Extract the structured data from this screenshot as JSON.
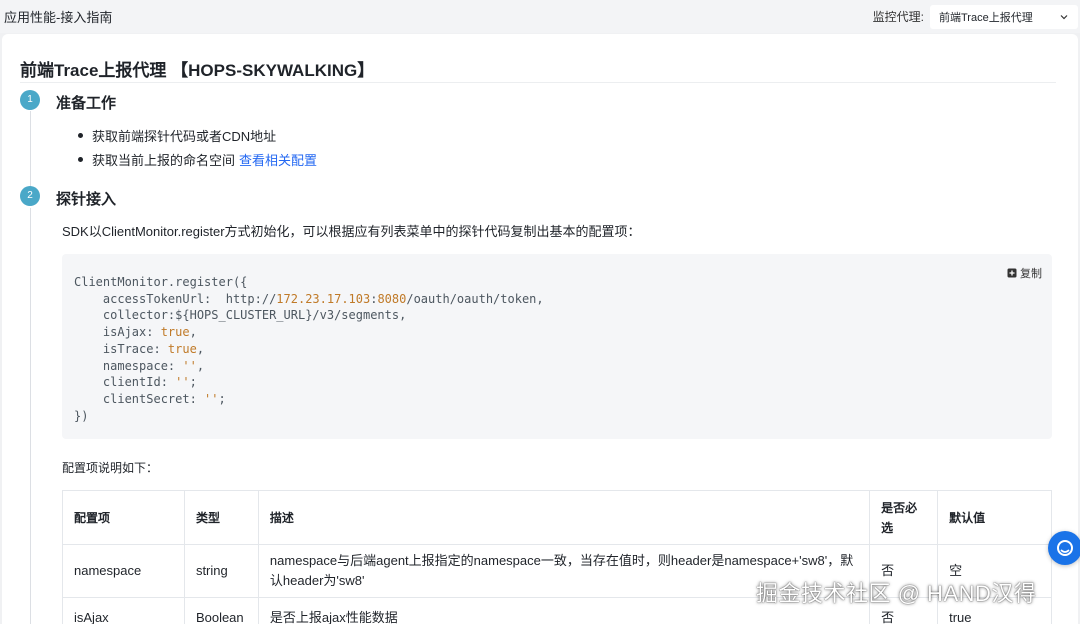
{
  "topbar": {
    "title": "应用性能-接入指南",
    "proxy_label": "监控代理:",
    "proxy_selected": "前端Trace上报代理"
  },
  "page": {
    "title": "前端Trace上报代理 【HOPS-SKYWALKING】"
  },
  "steps": [
    {
      "number": "1",
      "title": "准备工作",
      "bullets": [
        {
          "text": "获取前端探针代码或者CDN地址",
          "link": ""
        },
        {
          "text": "获取当前上报的命名空间",
          "link": "查看相关配置"
        }
      ]
    },
    {
      "number": "2",
      "title": "探针接入",
      "description": "SDK以ClientMonitor.register方式初始化，可以根据应有列表菜单中的探针代码复制出基本的配置项：",
      "copy_label": "复制",
      "code": {
        "line1": "ClientMonitor.register({",
        "l2_key": "    accessTokenUrl:  ",
        "l2_a": "http://",
        "l2_host": "172.23.17.103",
        "l2_b": ":",
        "l2_port": "8080",
        "l2_c": "/oauth/oauth/token,",
        "l3": "    collector:${HOPS_CLUSTER_URL}/v3/segments,",
        "l4_key": "    isAjax: ",
        "l4_val": "true",
        "l4_end": ",",
        "l5_key": "    isTrace: ",
        "l5_val": "true",
        "l5_end": ",",
        "l6_key": "    namespace: ",
        "l6_val": "''",
        "l6_end": ",",
        "l7_key": "    clientId: ",
        "l7_val": "''",
        "l7_end": ";",
        "l8_key": "    clientSecret: ",
        "l8_val": "''",
        "l8_end": ";",
        "l9": "})"
      },
      "config_label": "配置项说明如下："
    }
  ],
  "table": {
    "headers": [
      "配置项",
      "类型",
      "描述",
      "是否必选",
      "默认值"
    ],
    "rows": [
      {
        "name": "namespace",
        "type": "string",
        "desc": "namespace与后端agent上报指定的namespace一致，当存在值时，则header是namespace+'sw8'，默认header为'sw8'",
        "required": "否",
        "default": "空"
      },
      {
        "name": "isAjax",
        "type": "Boolean",
        "desc": "是否上报ajax性能数据",
        "required": "否",
        "default": "true"
      }
    ]
  },
  "watermark": "掘金技术社区 @ HAND汉得",
  "colors": {
    "accent": "#2468f2",
    "step": "#4aa8c8",
    "code_value": "#c07a28"
  },
  "icons": [
    "chevron-down-icon",
    "copy-icon",
    "assistant-icon"
  ]
}
